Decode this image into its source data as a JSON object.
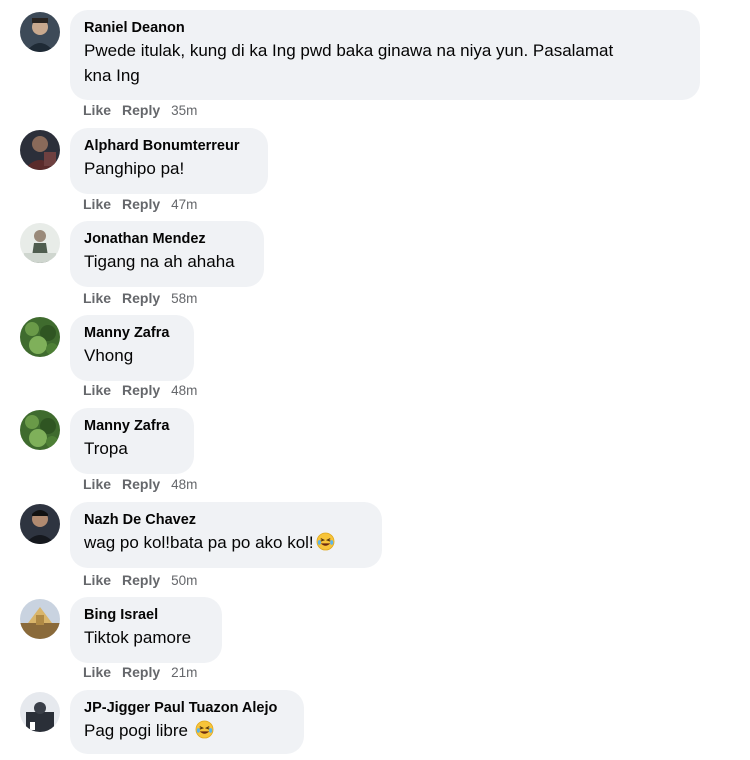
{
  "comments": [
    {
      "author": "Raniel Deanon",
      "text_line1": "Pwede itulak, kung di ka Ing pwd baka ginawa na niya yun. Pasalamat",
      "text_line2": "kna Ing",
      "like_label": "Like",
      "reply_label": "Reply",
      "time": "35m"
    },
    {
      "author": "Alphard Bonumterreur",
      "text": "Panghipo pa!",
      "like_label": "Like",
      "reply_label": "Reply",
      "time": "47m"
    },
    {
      "author": "Jonathan Mendez",
      "text": "Tigang na ah ahaha",
      "like_label": "Like",
      "reply_label": "Reply",
      "time": "58m"
    },
    {
      "author": "Manny Zafra",
      "text": "Vhong",
      "like_label": "Like",
      "reply_label": "Reply",
      "time": "48m"
    },
    {
      "author": "Manny Zafra",
      "text": "Tropa",
      "like_label": "Like",
      "reply_label": "Reply",
      "time": "48m"
    },
    {
      "author": "Nazh De Chavez",
      "text": "wag po kol!bata pa po ako kol!",
      "emoji": "laughing-tears-emoji",
      "like_label": "Like",
      "reply_label": "Reply",
      "time": "50m"
    },
    {
      "author": "Bing Israel",
      "text": "Tiktok pamore",
      "like_label": "Like",
      "reply_label": "Reply",
      "time": "21m"
    },
    {
      "author": "JP-Jigger Paul Tuazon Alejo",
      "text": "Pag pogi libre",
      "emoji": "laughing-tears-emoji"
    }
  ],
  "colors": {
    "bubble_bg": "#f0f2f5",
    "text": "#050505",
    "secondary": "#65676b"
  }
}
